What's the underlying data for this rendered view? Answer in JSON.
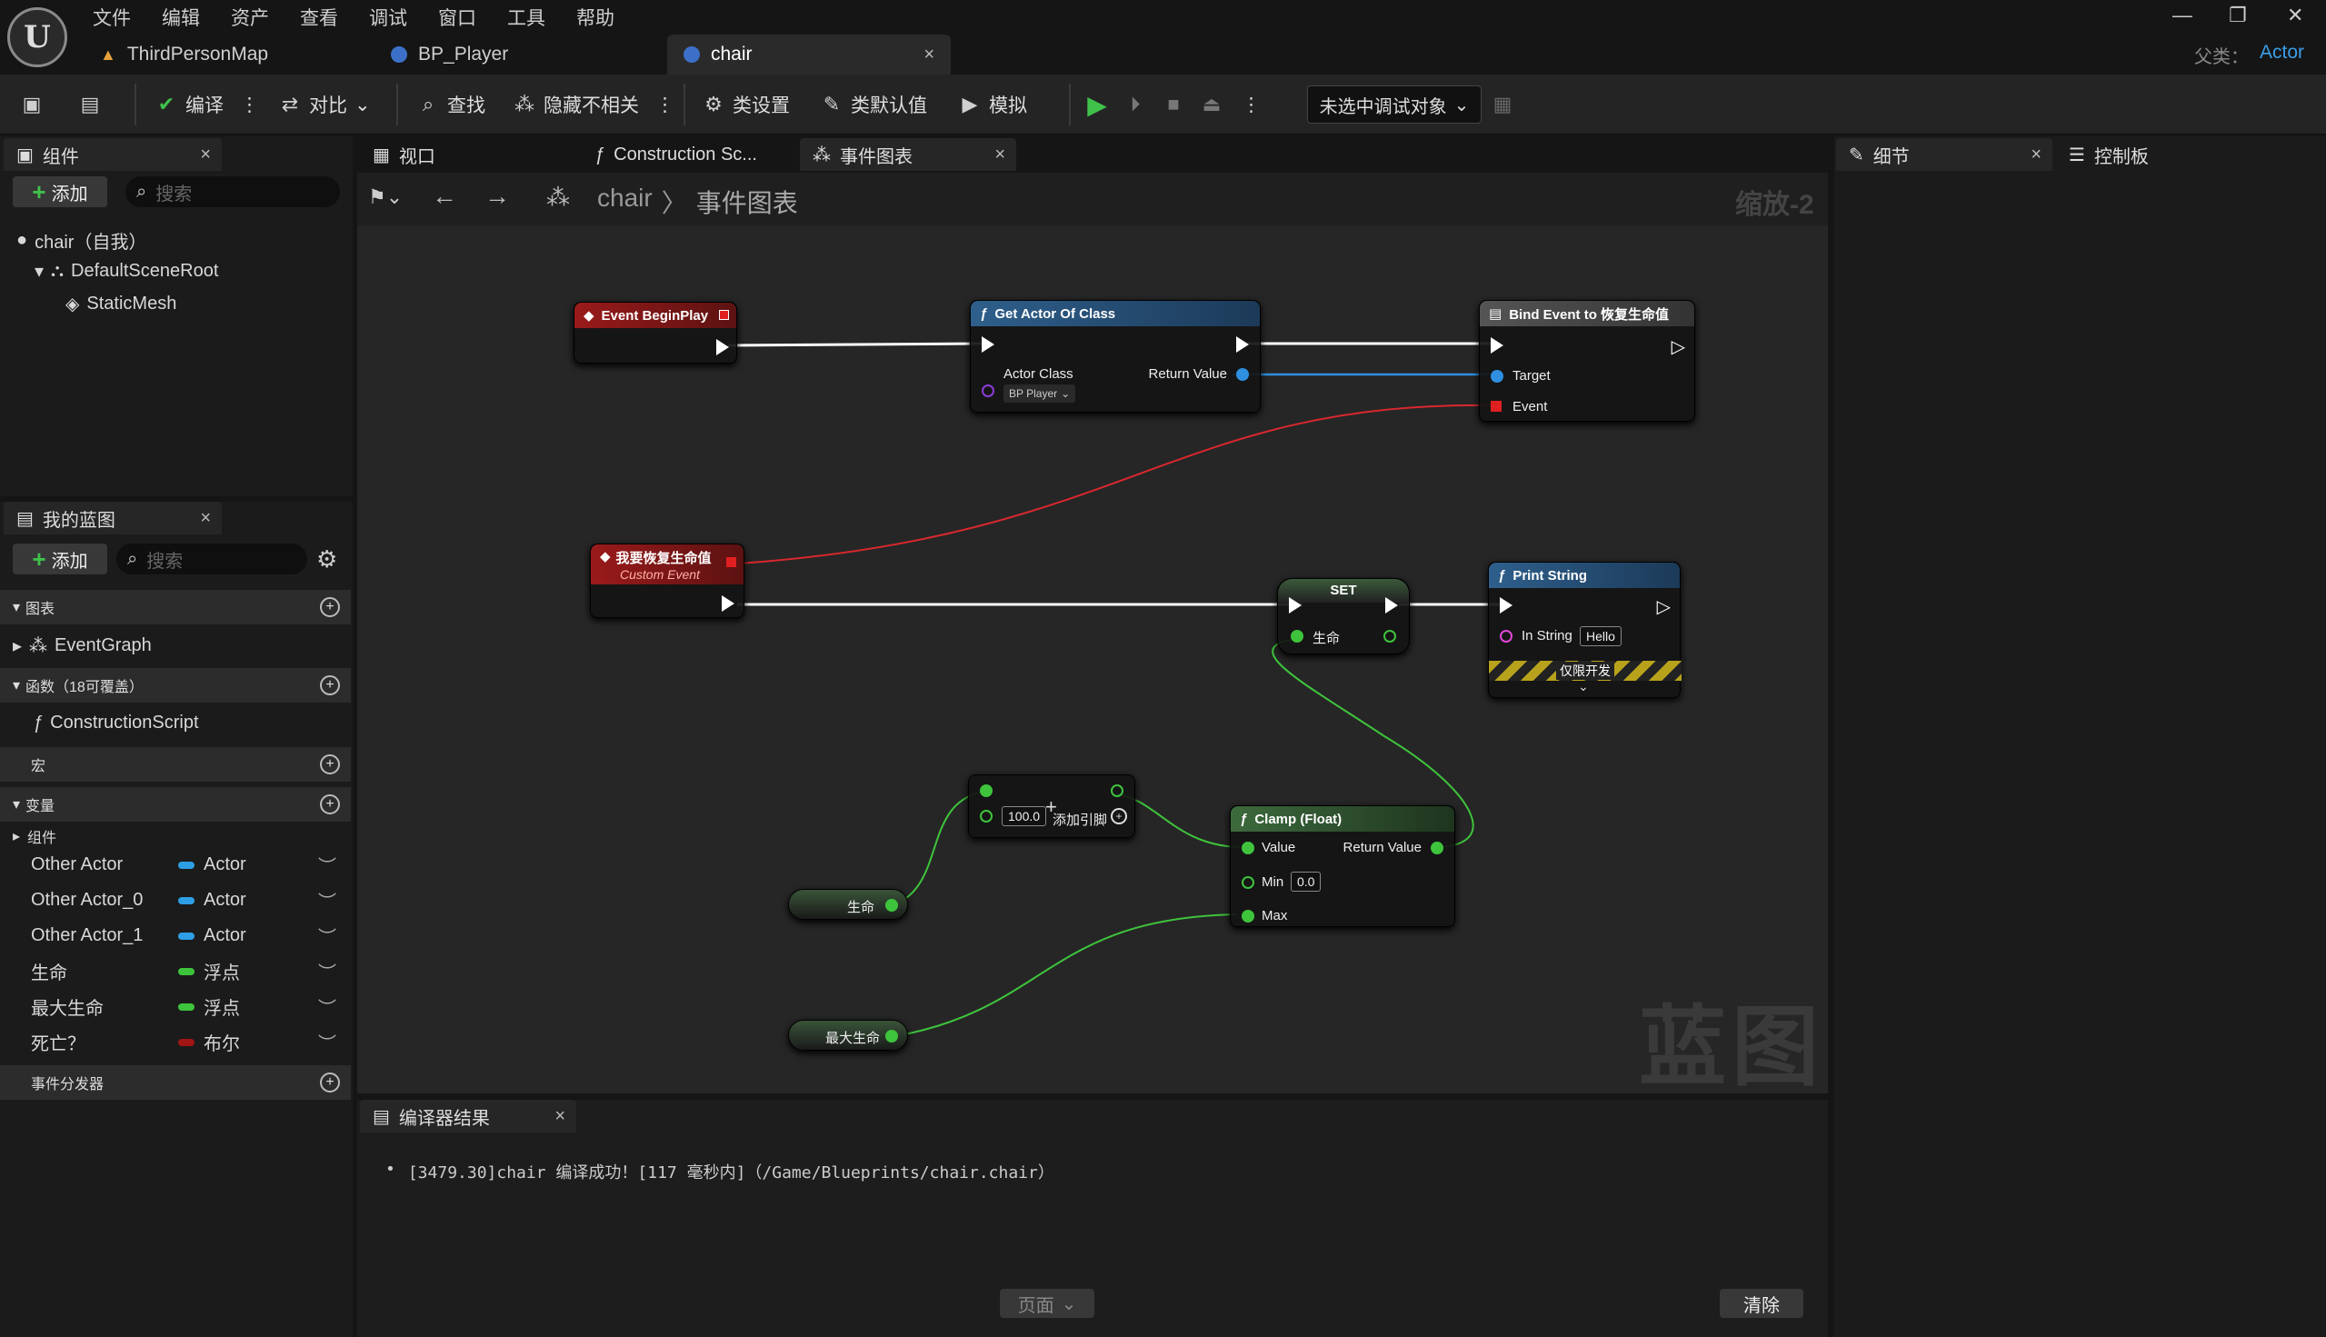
{
  "menu": [
    "文件",
    "编辑",
    "资产",
    "查看",
    "调试",
    "窗口",
    "工具",
    "帮助"
  ],
  "window": {
    "parent_label": "父类：",
    "parent_value": "Actor",
    "min": "—",
    "restore": "❐",
    "close": "✕"
  },
  "doc_tabs": [
    {
      "label": "ThirdPersonMap"
    },
    {
      "label": "BP_Player"
    },
    {
      "label": "chair",
      "close": "×"
    }
  ],
  "toolbar": {
    "compile": "编译",
    "diff": "对比",
    "find": "查找",
    "hide_unrelated": "隐藏不相关",
    "class_settings": "类设置",
    "class_defaults": "类默认值",
    "simulate": "模拟",
    "debug_select": "未选中调试对象"
  },
  "components_panel": {
    "tab": "组件",
    "add": "添加",
    "search_placeholder": "搜索",
    "tree": [
      "chair（自我）",
      "DefaultSceneRoot",
      "StaticMesh"
    ]
  },
  "my_blueprint": {
    "tab": "我的蓝图",
    "add": "添加",
    "search_placeholder": "搜索",
    "graphs_label": "图表",
    "event_graph": "EventGraph",
    "functions_label": "函数（18可覆盖）",
    "construction_script": "ConstructionScript",
    "macros_label": "宏",
    "variables_label": "变量",
    "components_group": "组件",
    "variables": [
      {
        "name": "Other Actor",
        "type": "Actor",
        "color": "#2e9fe5"
      },
      {
        "name": "Other Actor_0",
        "type": "Actor",
        "color": "#2e9fe5"
      },
      {
        "name": "Other Actor_1",
        "type": "Actor",
        "color": "#2e9fe5"
      },
      {
        "name": "生命",
        "type": "浮点",
        "color": "#3ec43c"
      },
      {
        "name": "最大生命",
        "type": "浮点",
        "color": "#3ec43c"
      },
      {
        "name": "死亡？",
        "type": "布尔",
        "color": "#a11515"
      }
    ],
    "dispatchers_label": "事件分发器"
  },
  "graph_tabs": [
    {
      "label": "视口"
    },
    {
      "label": "Construction Sc..."
    },
    {
      "label": "事件图表",
      "close": "×"
    }
  ],
  "breadcrumb": {
    "root": "chair",
    "sep": "〉",
    "current": "事件图表",
    "zoom": "缩放-2"
  },
  "watermark": "蓝图",
  "nodes": {
    "begin_play": {
      "title": "Event BeginPlay"
    },
    "get_actor": {
      "title": "Get Actor Of Class",
      "actor_class": "Actor Class",
      "class_value": "BP Player",
      "return_value": "Return Value"
    },
    "bind_event": {
      "title": "Bind Event to 恢复生命值",
      "target": "Target",
      "event": "Event"
    },
    "custom_event": {
      "title": "我要恢复生命值",
      "subtitle": "Custom Event"
    },
    "set": {
      "title": "SET",
      "var": "生命"
    },
    "print_string": {
      "title": "Print String",
      "in_string": "In String",
      "value": "Hello",
      "dev_only": "仅限开发"
    },
    "add": {
      "value": "100.0",
      "add_pin": "添加引脚"
    },
    "clamp": {
      "title": "Clamp (Float)",
      "value": "Value",
      "return_value": "Return Value",
      "min": "Min",
      "min_value": "0.0",
      "max": "Max"
    },
    "get_life": {
      "label": "生命"
    },
    "get_max_life": {
      "label": "最大生命"
    }
  },
  "details_panel": {
    "tab": "细节",
    "tab2": "控制板"
  },
  "compiler": {
    "tab": "编译器结果",
    "message": "[3479.30]chair 编译成功！[117 毫秒内]（/Game/Blueprints/chair.chair）",
    "page": "页面",
    "clear": "清除"
  }
}
